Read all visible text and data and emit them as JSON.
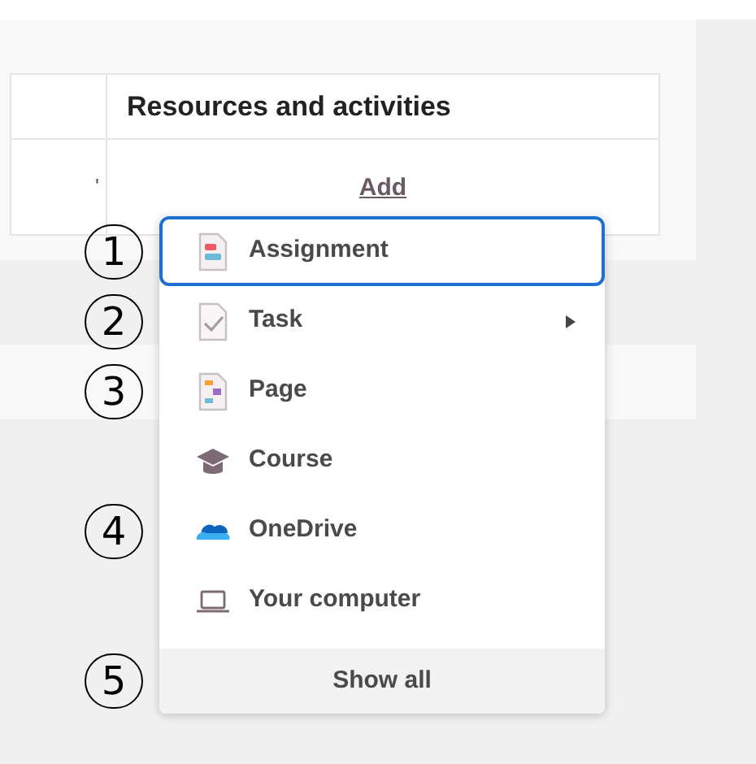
{
  "table": {
    "columns": [
      "",
      "Resources and activities"
    ],
    "rows": [
      {
        "column_1": "'",
        "resources_and_activities": "Add"
      }
    ]
  },
  "menu": {
    "items": [
      {
        "label": "Assignment",
        "kind": "assignment",
        "selected": true,
        "submenu": false,
        "marker": "1"
      },
      {
        "label": "Task",
        "kind": "task",
        "selected": false,
        "submenu": true,
        "marker": "2"
      },
      {
        "label": "Page",
        "kind": "page",
        "selected": false,
        "submenu": false,
        "marker": "3"
      },
      {
        "label": "Course",
        "kind": "course",
        "selected": false,
        "submenu": false
      },
      {
        "label": "OneDrive",
        "kind": "onedrive",
        "selected": false,
        "submenu": false,
        "marker": "4"
      },
      {
        "label": "Your computer",
        "kind": "computer",
        "selected": false,
        "submenu": false
      }
    ],
    "footer": {
      "label": "Show all",
      "marker": "5"
    }
  }
}
